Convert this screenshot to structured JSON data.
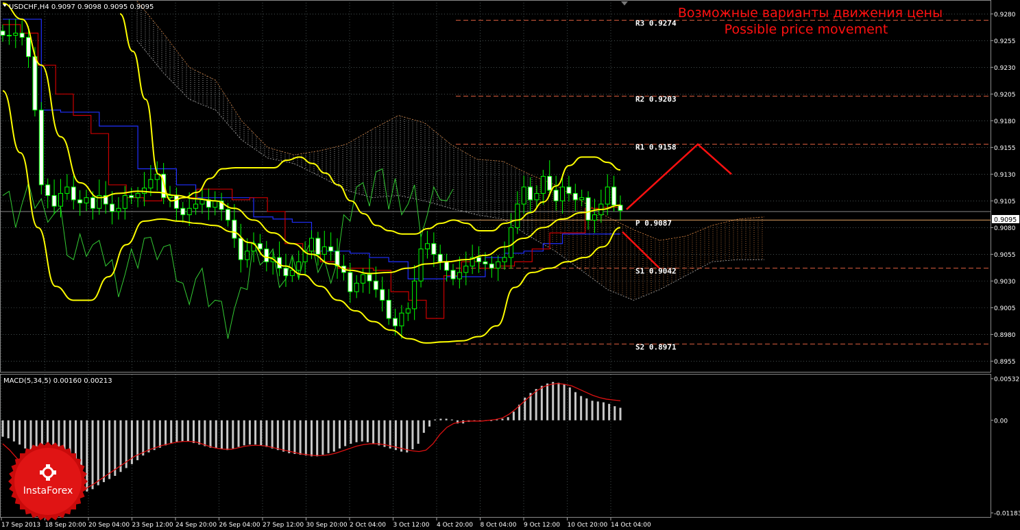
{
  "header": {
    "symbol_label": "USDCHF,H4  0.9097 0.9098 0.9095 0.9095",
    "title_ru": "Возможные варианты движения цены",
    "title_en": "Possible price movement"
  },
  "macd_label": "MACD(5,34,5) 0.00160 0.00213",
  "logo_text": "InstaForex",
  "colors": {
    "background": "#000000",
    "grid": "#6f7f7f",
    "bullish": "#00ff00",
    "bollinger": "#ffff00",
    "kijun": "#2030ff",
    "tenkan": "#cc0000",
    "chikou": "#33cc33",
    "pivot_line": "#e06040",
    "forecast": "#ff1010",
    "macd_hist": "#c8c8c8",
    "macd_signal": "#dd1111",
    "title_red": "#ff1010",
    "last_price_box": "#ffffff"
  },
  "chart_data": [
    {
      "type": "candlestick",
      "symbol": "USDCHF",
      "timeframe": "H4",
      "ylim": [
        0.8945,
        0.9293
      ],
      "y_ticks": [
        "0.9280",
        "0.9255",
        "0.9230",
        "0.9205",
        "0.9180",
        "0.9155",
        "0.9130",
        "0.9105",
        "0.9080",
        "0.9055",
        "0.9030",
        "0.9005",
        "0.8980",
        "0.8955"
      ],
      "x_ticks": [
        "17 Sep 2013",
        "18 Sep 20:00",
        "20 Sep 04:00",
        "23 Sep 12:00",
        "24 Sep 20:00",
        "26 Sep 04:00",
        "27 Sep 12:00",
        "30 Sep 20:00",
        "2 Oct 04:00",
        "3 Oct 12:00",
        "4 Oct 20:00",
        "8 Oct 04:00",
        "9 Oct 12:00",
        "10 Oct 20:00",
        "14 Oct 04:00"
      ],
      "last_price": "0.9095",
      "levels": [
        {
          "name": "R3",
          "value": "0.9274"
        },
        {
          "name": "R2",
          "value": "0.9203"
        },
        {
          "name": "R1",
          "value": "0.9158"
        },
        {
          "name": "P",
          "value": "0.9087"
        },
        {
          "name": "S1",
          "value": "0.9042"
        },
        {
          "name": "S2",
          "value": "0.8971"
        }
      ],
      "close_path": [
        0.926,
        0.926,
        0.9262,
        0.9258,
        0.924,
        0.919,
        0.912,
        0.911,
        0.91,
        0.9112,
        0.9118,
        0.9106,
        0.9103,
        0.9108,
        0.9098,
        0.911,
        0.9102,
        0.9095,
        0.9098,
        0.911,
        0.9108,
        0.9112,
        0.9117,
        0.9125,
        0.913,
        0.9108,
        0.911,
        0.9098,
        0.9092,
        0.9098,
        0.9102,
        0.9106,
        0.9099,
        0.9105,
        0.9097,
        0.9087,
        0.907,
        0.905,
        0.9058,
        0.9065,
        0.906,
        0.9048,
        0.9052,
        0.9042,
        0.9035,
        0.904,
        0.9048,
        0.9058,
        0.907,
        0.9055,
        0.9062,
        0.9058,
        0.9044,
        0.9038,
        0.902,
        0.9028,
        0.9036,
        0.903,
        0.9022,
        0.9012,
        0.8995,
        0.8988,
        0.9,
        0.9004,
        0.903,
        0.906,
        0.9065,
        0.9055,
        0.9048,
        0.904,
        0.9032,
        0.9038,
        0.9044,
        0.9052,
        0.9048,
        0.9046,
        0.9042,
        0.9048,
        0.9052,
        0.908,
        0.9102,
        0.9118,
        0.9106,
        0.9112,
        0.9128,
        0.9115,
        0.9105,
        0.9118,
        0.9112,
        0.9106,
        0.9108,
        0.9087,
        0.9092,
        0.9102,
        0.9118,
        0.9101,
        0.9096
      ],
      "bollinger_upper": [
        0.928,
        0.9245,
        0.92,
        0.913,
        0.9105,
        0.9108,
        0.9113,
        0.9126,
        0.9135,
        0.9136,
        0.9136,
        0.9136,
        0.9136,
        0.9143,
        0.9146,
        0.914,
        0.9131,
        0.912,
        0.9105,
        0.9093,
        0.9082,
        0.9077,
        0.9074,
        0.9074,
        0.9079,
        0.9084,
        0.9087,
        0.9084,
        0.9077,
        0.9077,
        0.9084,
        0.9087,
        0.9094,
        0.9104,
        0.9119,
        0.9138,
        0.9146,
        0.9146,
        0.9141,
        0.9134
      ],
      "bollinger_middle": [
        0.929,
        0.9275,
        0.9232,
        0.9165,
        0.9122,
        0.9108,
        0.9112,
        0.9114,
        0.9113,
        0.911,
        0.9107,
        0.9105,
        0.9098,
        0.9087,
        0.9075,
        0.9065,
        0.9055,
        0.9046,
        0.904,
        0.9037,
        0.9038,
        0.9042,
        0.9046,
        0.9048,
        0.905,
        0.9054,
        0.9062,
        0.907,
        0.908,
        0.9088,
        0.9094,
        0.9097,
        0.9101
      ],
      "bollinger_lower": [
        0.9208,
        0.915,
        0.908,
        0.9025,
        0.9012,
        0.9012,
        0.9034,
        0.9064,
        0.9086,
        0.9088,
        0.9086,
        0.9084,
        0.9082,
        0.9076,
        0.9066,
        0.9052,
        0.9044,
        0.9036,
        0.9025,
        0.9012,
        0.9002,
        0.8992,
        0.8984,
        0.8976,
        0.8972,
        0.8973,
        0.8974,
        0.8978,
        0.8988,
        0.9024,
        0.9038,
        0.9042,
        0.9048,
        0.9052,
        0.9062,
        0.908
      ],
      "kijun": [
        0.9275,
        0.9275,
        0.919,
        0.9188,
        0.9188,
        0.9175,
        0.9175,
        0.9135,
        0.9135,
        0.912,
        0.9108,
        0.9108,
        0.9108,
        0.909,
        0.9088,
        0.9085,
        0.9058,
        0.9058,
        0.9056,
        0.9052,
        0.9048,
        0.9032,
        0.9032,
        0.9034,
        0.9034,
        0.9052,
        0.9056,
        0.9058,
        0.9065,
        0.9074,
        0.9074,
        0.9074
      ],
      "tenkan": [
        0.927,
        0.9262,
        0.9232,
        0.9205,
        0.9185,
        0.9168,
        0.912,
        0.9108,
        0.9105,
        0.9108,
        0.9108,
        0.9116,
        0.9116,
        0.9106,
        0.9108,
        0.9095,
        0.9065,
        0.9058,
        0.9048,
        0.9042,
        0.9042,
        0.904,
        0.902,
        0.9012,
        0.8995,
        0.9035,
        0.9048,
        0.9042,
        0.9044,
        0.9048,
        0.906,
        0.9075,
        0.9075,
        0.9098,
        0.9099
      ],
      "forecast_up": [
        {
          "t": 0.9097,
          "p": 0.9097
        },
        {
          "t": 0.9158,
          "p": 0.9158
        },
        {
          "t": 0.913,
          "p": 0.913
        }
      ],
      "forecast_down": [
        {
          "t": 0.9075,
          "p": 0.9075
        },
        {
          "t": 0.9042,
          "p": 0.9042
        }
      ]
    },
    {
      "type": "bar",
      "name": "MACD(5,34,5)",
      "values_label": "0.00160 0.00213",
      "ylim": [
        -0.01183,
        0.00532
      ],
      "y_ticks": [
        "0.00532",
        "0.00",
        "-0.01183"
      ],
      "histogram": [
        -0.0021,
        -0.0023,
        -0.0027,
        -0.0031,
        -0.0036,
        -0.0042,
        -0.0052,
        -0.0061,
        -0.0072,
        -0.0081,
        -0.0088,
        -0.0092,
        -0.0095,
        -0.0095,
        -0.0094,
        -0.0091,
        -0.0088,
        -0.0083,
        -0.0079,
        -0.0075,
        -0.0071,
        -0.0066,
        -0.0061,
        -0.0056,
        -0.0051,
        -0.0045,
        -0.0041,
        -0.0038,
        -0.0035,
        -0.0032,
        -0.0029,
        -0.0028,
        -0.0027,
        -0.0027,
        -0.0029,
        -0.0031,
        -0.0033,
        -0.0035,
        -0.0036,
        -0.0037,
        -0.0038,
        -0.0036,
        -0.0034,
        -0.0032,
        -0.0031,
        -0.0031,
        -0.0032,
        -0.0034,
        -0.0036,
        -0.0038,
        -0.004,
        -0.0042,
        -0.0043,
        -0.0044,
        -0.0045,
        -0.0046,
        -0.0046,
        -0.0044,
        -0.0042,
        -0.004,
        -0.0036,
        -0.0033,
        -0.003,
        -0.0028,
        -0.0027,
        -0.0028,
        -0.003,
        -0.0032,
        -0.0034,
        -0.0036,
        -0.0038,
        -0.004,
        -0.0041,
        -0.0037,
        -0.003,
        -0.0016,
        -0.0008,
        0.0001,
        0.0002,
        0.0002,
        0.0001,
        -0.0004,
        -0.0004,
        -0.0002,
        0.0,
        -0.0001,
        -0.0001,
        0.0,
        0.0001,
        0.0002,
        0.0004,
        0.0011,
        0.002,
        0.0029,
        0.0035,
        0.004,
        0.0044,
        0.0047,
        0.0049,
        0.0048,
        0.0046,
        0.0042,
        0.0036,
        0.0031,
        0.0028,
        0.0025,
        0.0024,
        0.0023,
        0.0021,
        0.0018,
        0.0016
      ],
      "signal": [
        -0.003,
        -0.0038,
        -0.0048,
        -0.0058,
        -0.0068,
        -0.0077,
        -0.0085,
        -0.0091,
        -0.0093,
        -0.0094,
        -0.0093,
        -0.0091,
        -0.0087,
        -0.0082,
        -0.0076,
        -0.007,
        -0.0064,
        -0.0058,
        -0.0052,
        -0.0046,
        -0.0042,
        -0.0038,
        -0.0035,
        -0.0032,
        -0.003,
        -0.0028,
        -0.0027,
        -0.0027,
        -0.0028,
        -0.0031,
        -0.0034,
        -0.0036,
        -0.0037,
        -0.0037,
        -0.0035,
        -0.0033,
        -0.0032,
        -0.0032,
        -0.0033,
        -0.0035,
        -0.0037,
        -0.0039,
        -0.0041,
        -0.0043,
        -0.0044,
        -0.0045,
        -0.0045,
        -0.0044,
        -0.0042,
        -0.0039,
        -0.0036,
        -0.0033,
        -0.0031,
        -0.003,
        -0.003,
        -0.0031,
        -0.0033,
        -0.0035,
        -0.0037,
        -0.0039,
        -0.004,
        -0.0038,
        -0.003,
        -0.0018,
        -0.0009,
        -0.0004,
        -0.0002,
        -0.0001,
        -0.0001,
        -0.0001,
        0.0,
        0.0001,
        0.0003,
        0.0008,
        0.0015,
        0.0023,
        0.0031,
        0.0038,
        0.0043,
        0.0046,
        0.0047,
        0.0046,
        0.0044,
        0.004,
        0.0036,
        0.0032,
        0.0029,
        0.0027,
        0.0026,
        0.0025
      ]
    }
  ]
}
